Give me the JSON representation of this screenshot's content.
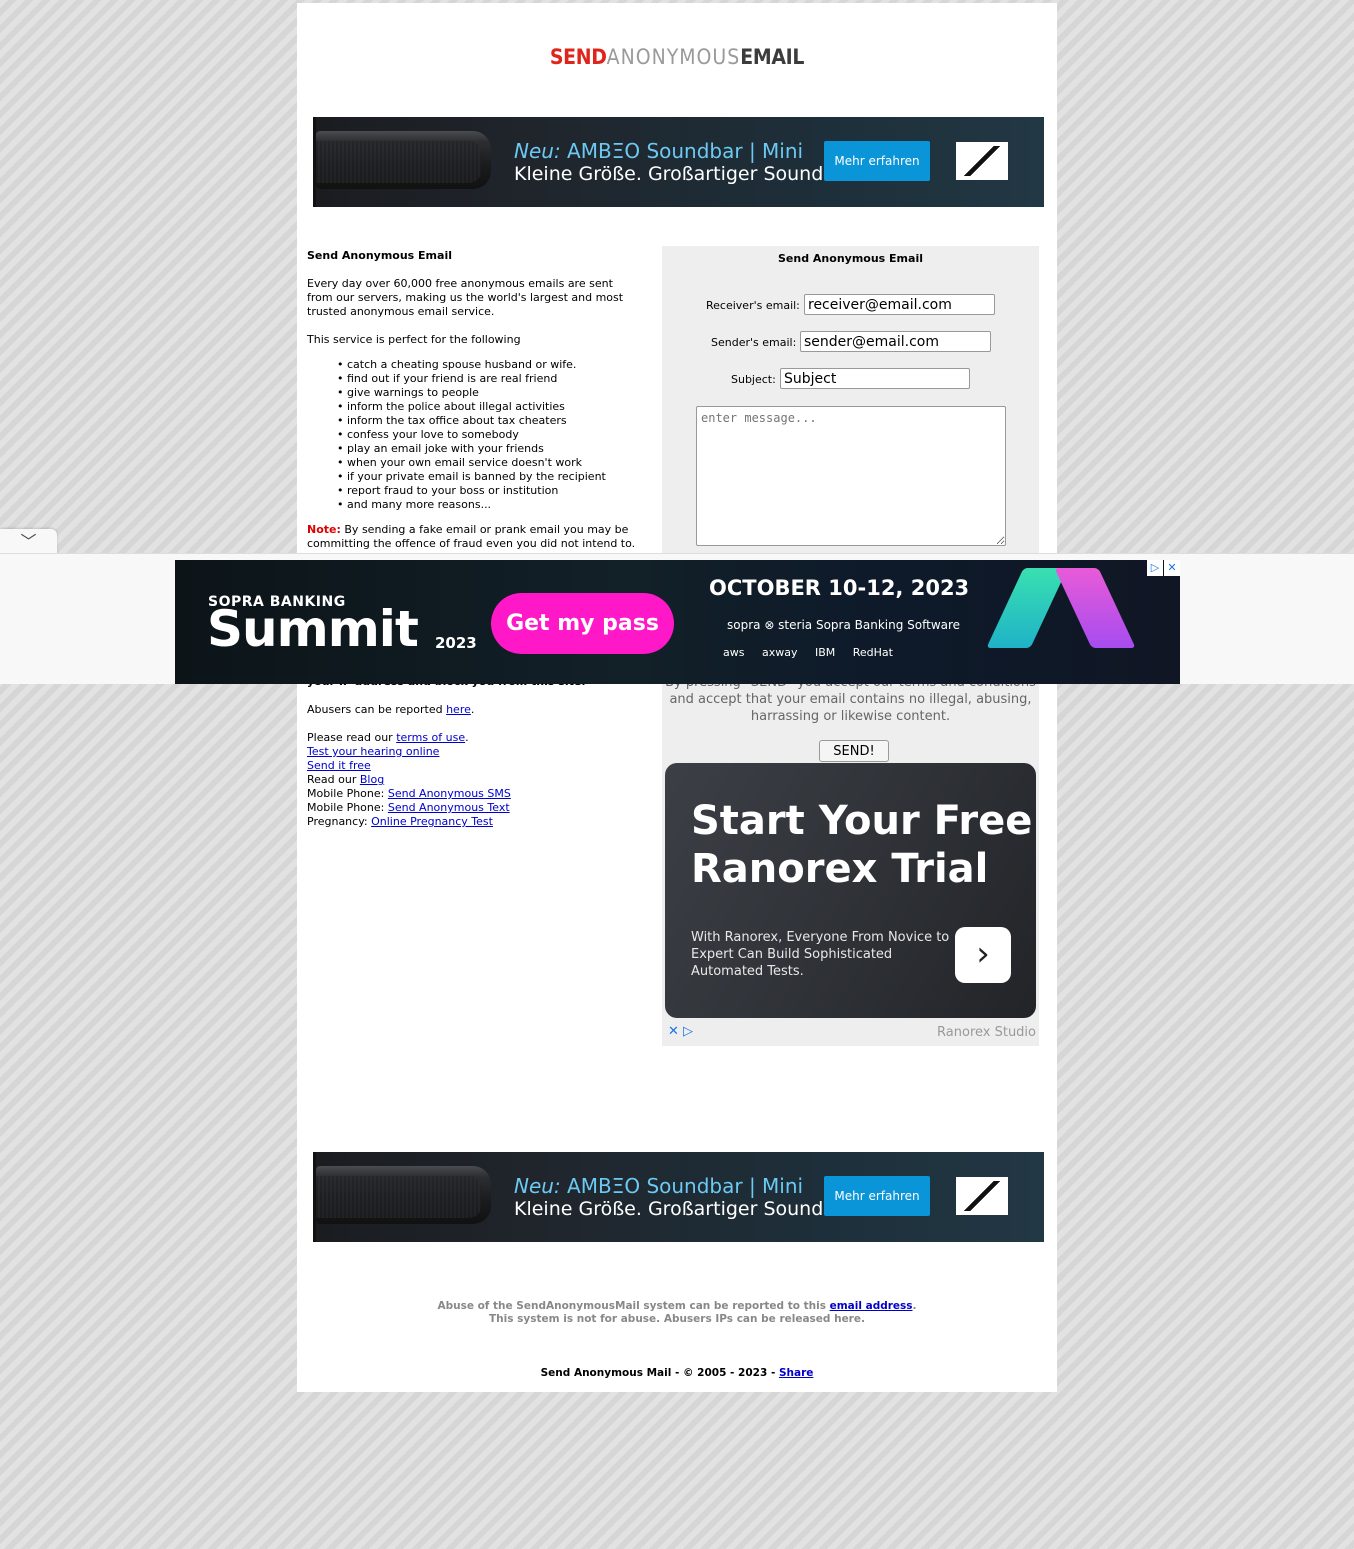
{
  "logo": {
    "part1": "SEND",
    "part2": "ANONYMOUS",
    "part3": "EMAIL"
  },
  "banner_ad": {
    "headline_italic": "Neu:",
    "headline_rest": " AMBΞO  Soundbar | Mini",
    "subline": "Kleine Größe. Großartiger Sound.",
    "button": "Mehr erfahren"
  },
  "left": {
    "heading": "Send Anonymous Email",
    "intro": "Every day over 60,000 free anonymous emails are sent from our servers, making us the world's largest and most trusted anonymous email service.",
    "perfect_for": "This service is perfect for the following",
    "uses": [
      "catch a cheating spouse husband or wife.",
      "find out if your friend is are real friend",
      "give warnings to people",
      "inform the police about illegal activities",
      "inform the tax office about tax cheaters",
      "confess your love to somebody",
      "play an email joke with your friends",
      "when your own email service doesn't work",
      "if your private email is banned by the recipient",
      "report fraud to your boss or institution",
      "and many more reasons..."
    ],
    "note_label": "Note:",
    "note_text": " By sending a fake email or prank email you may be committing the offence of fraud even you did not intend to. You are not allowed to use this service for any illegal",
    "warning_tail": "your IP address and block you from this site.",
    "abusers_prefix": "Abusers can be reported ",
    "abusers_link": "here",
    "period": ".",
    "read_prefix": "Please read our ",
    "terms_link": "terms of use",
    "hearing_link": "Test your hearing online",
    "sendit_link": "Send it free",
    "blog_prefix": "Read our ",
    "blog_link": "Blog",
    "mobile_prefix": "Mobile Phone: ",
    "sms_link": "Send Anonymous SMS",
    "text_link": "Send Anonymous Text",
    "pregnancy_prefix": "Pregnancy: ",
    "pregnancy_link": "Online Pregnancy Test"
  },
  "form": {
    "title": "Send Anonymous Email",
    "receiver_label": "Receiver's email:",
    "receiver_value": "receiver@email.com",
    "sender_label": "Sender's email:",
    "sender_value": "sender@email.com",
    "subject_label": "Subject:",
    "subject_value": "Subject",
    "message_placeholder": "enter message...",
    "accept_text": "By pressing \"SEND\" you accept our terms and conditions and accept that your email contains no illegal, abusing, harrassing or likewise content.",
    "send_button": "SEND!"
  },
  "ranorex_ad": {
    "title": "Start Your Free Ranorex Trial",
    "subtitle": "With Ranorex, Everyone From Novice to Expert Can Build Sophisticated Automated Tests.",
    "source": "Ranorex Studio"
  },
  "overlay_ad": {
    "brand": "SOPRA BANKING",
    "title": "Summit",
    "year": "2023",
    "cta": "Get my pass",
    "dates": "OCTOBER 10-12, 2023",
    "partners1": "sopra ⊗ steria    Sopra Banking Software",
    "partners2": "aws axway IBM RedHat"
  },
  "footer": {
    "abuse_prefix": "Abuse of the SendAnonymousMail system can be reported to this ",
    "abuse_link": "email address",
    "abuse_line2": "This system is not for abuse. Abusers IPs can be released here.",
    "copyright": "Send Anonymous Mail - © 2005 - 2023 - ",
    "share_link": "Share"
  }
}
